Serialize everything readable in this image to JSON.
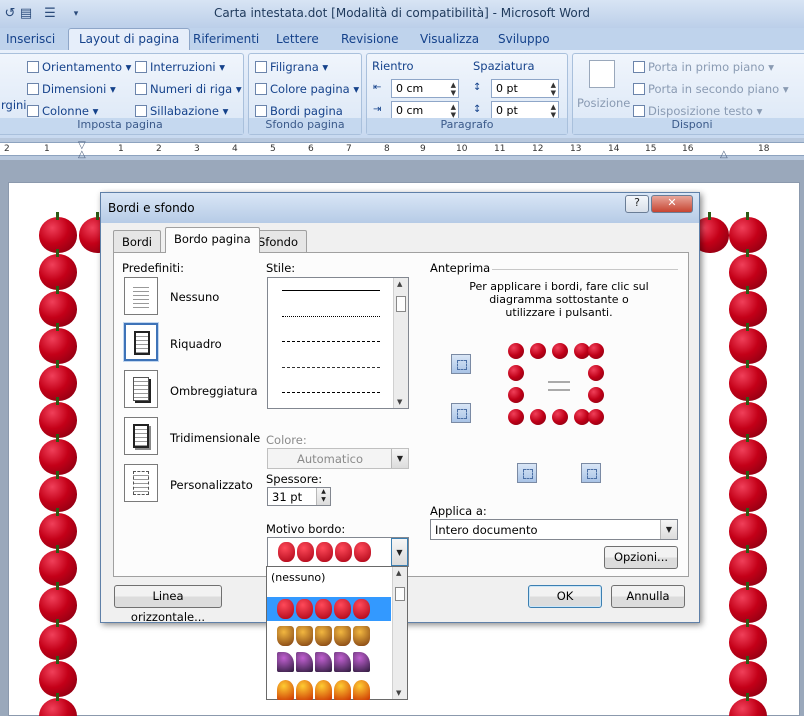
{
  "window": {
    "title": "Carta intestata.dot [Modalità di compatibilità] - Microsoft Word"
  },
  "ribbon_tabs": [
    "Inserisci",
    "Layout di pagina",
    "Riferimenti",
    "Lettere",
    "Revisione",
    "Visualizza",
    "Sviluppo"
  ],
  "ribbon": {
    "imposta": {
      "margini": "rgini",
      "orientamento": "Orientamento",
      "dimensioni": "Dimensioni",
      "colonne": "Colonne",
      "interruzioni": "Interruzioni",
      "numeri": "Numeri di riga",
      "sillabazione": "Sillabazione",
      "label": "Imposta pagina"
    },
    "sfondo": {
      "filigrana": "Filigrana",
      "colore": "Colore pagina",
      "bordi": "Bordi pagina",
      "label": "Sfondo pagina"
    },
    "paragrafo": {
      "rientro": "Rientro",
      "spaziatura": "Spaziatura",
      "rientro_sx": "0 cm",
      "rientro_dx": "0 cm",
      "spaz_prima": "0 pt",
      "spaz_dopo": "0 pt",
      "label": "Paragrafo"
    },
    "disponi": {
      "posizione": "Posizione",
      "primo_piano": "Porta in primo piano",
      "secondo_piano": "Porta in secondo piano",
      "disposizione": "Disposizione testo",
      "label": "Disponi"
    }
  },
  "ruler_numbers": [
    "2",
    "1",
    "1",
    "2",
    "3",
    "4",
    "5",
    "6",
    "7",
    "8",
    "9",
    "10",
    "11",
    "12",
    "13",
    "14",
    "15",
    "16",
    "18"
  ],
  "dialog": {
    "title": "Bordi e sfondo",
    "help": "?",
    "close": "✕",
    "tabs": [
      "Bordi",
      "Bordo pagina",
      "Sfondo"
    ],
    "predefiniti_label": "Predefiniti:",
    "presets": [
      "Nessuno",
      "Riquadro",
      "Ombreggiatura",
      "Tridimensionale",
      "Personalizzato"
    ],
    "stile_label": "Stile:",
    "colore_label": "Colore:",
    "colore_value": "Automatico",
    "spessore_label": "Spessore:",
    "spessore_value": "31 pt",
    "motivo_label": "Motivo bordo:",
    "motivo_options": [
      "(nessuno)"
    ],
    "anteprima_label": "Anteprima",
    "anteprima_hint": "Per applicare i bordi, fare clic sul diagramma sottostante o utilizzare i pulsanti.",
    "applica_label": "Applica a:",
    "applica_value": "Intero documento",
    "opzioni_btn": "Opzioni...",
    "linea_btn": "Linea orizzontale...",
    "ok_btn": "OK",
    "annulla_btn": "Annulla"
  },
  "colors": {
    "accent": "#3e73b8",
    "apple_red": "#c40018",
    "ribbon": "#dbe7f6"
  }
}
